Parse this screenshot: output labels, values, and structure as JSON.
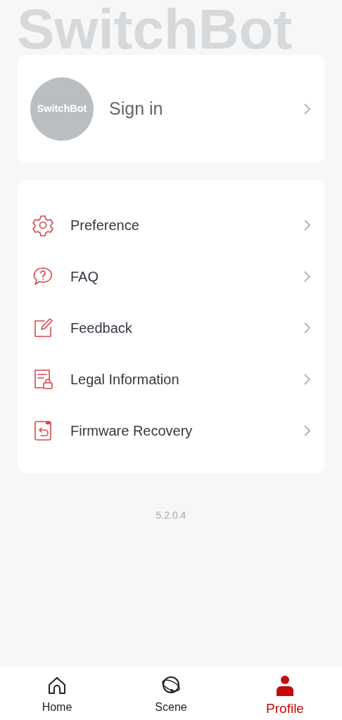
{
  "header": {
    "brand": "SwitchBot"
  },
  "account": {
    "avatar_text": "SwitchBot",
    "label": "Sign in"
  },
  "menu": [
    {
      "label": "Preference"
    },
    {
      "label": "FAQ"
    },
    {
      "label": "Feedback"
    },
    {
      "label": "Legal Information"
    },
    {
      "label": "Firmware Recovery"
    }
  ],
  "version": "5.2.0.4",
  "tabs": [
    {
      "label": "Home",
      "selected": false
    },
    {
      "label": "Scene",
      "selected": false
    },
    {
      "label": "Profile",
      "selected": true
    }
  ]
}
